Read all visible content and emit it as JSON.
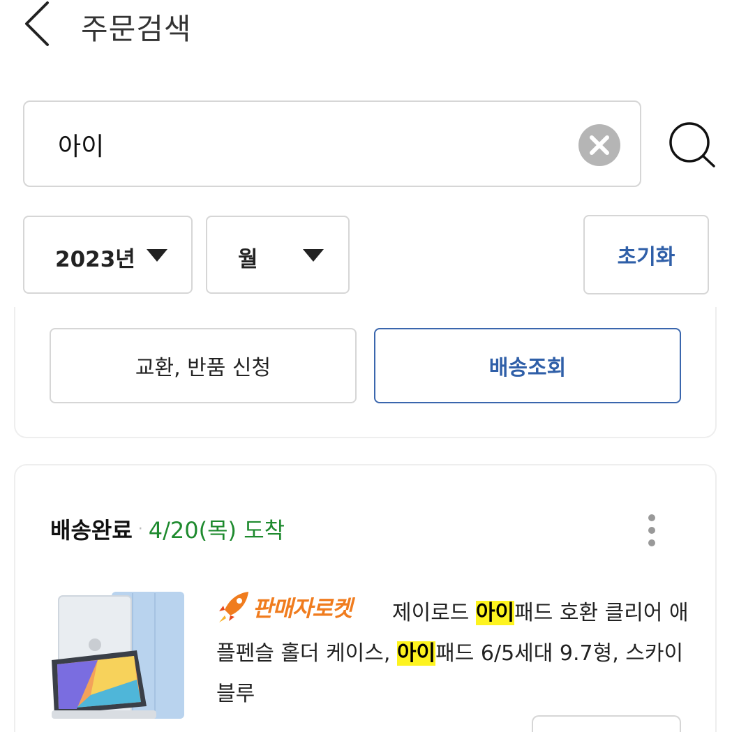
{
  "header": {
    "title": "주문검색"
  },
  "search": {
    "value": "아이"
  },
  "filters": {
    "year": "2023년",
    "month": "월",
    "reset_label": "초기화"
  },
  "actions": {
    "exchange_label": "교환, 반품 신청",
    "track_label": "배송조회"
  },
  "order": {
    "status": "배송완료",
    "separator": "·",
    "arrival": "4/20(목) 도착",
    "badge": "판매자로켓",
    "name_before": "제이로드 ",
    "name_hl1": "아이",
    "name_mid": "패드 호환 클리어 애플펜슬 홀더 케이스, ",
    "name_hl2": "아이",
    "name_after": "패드 6/5세대 9.7형, 스카이블루"
  },
  "colors": {
    "accent_blue": "#2f5fa8",
    "arrival_green": "#1e8a2e",
    "rocket_orange": "#f07c1e",
    "highlight_yellow": "#fdf31f"
  }
}
